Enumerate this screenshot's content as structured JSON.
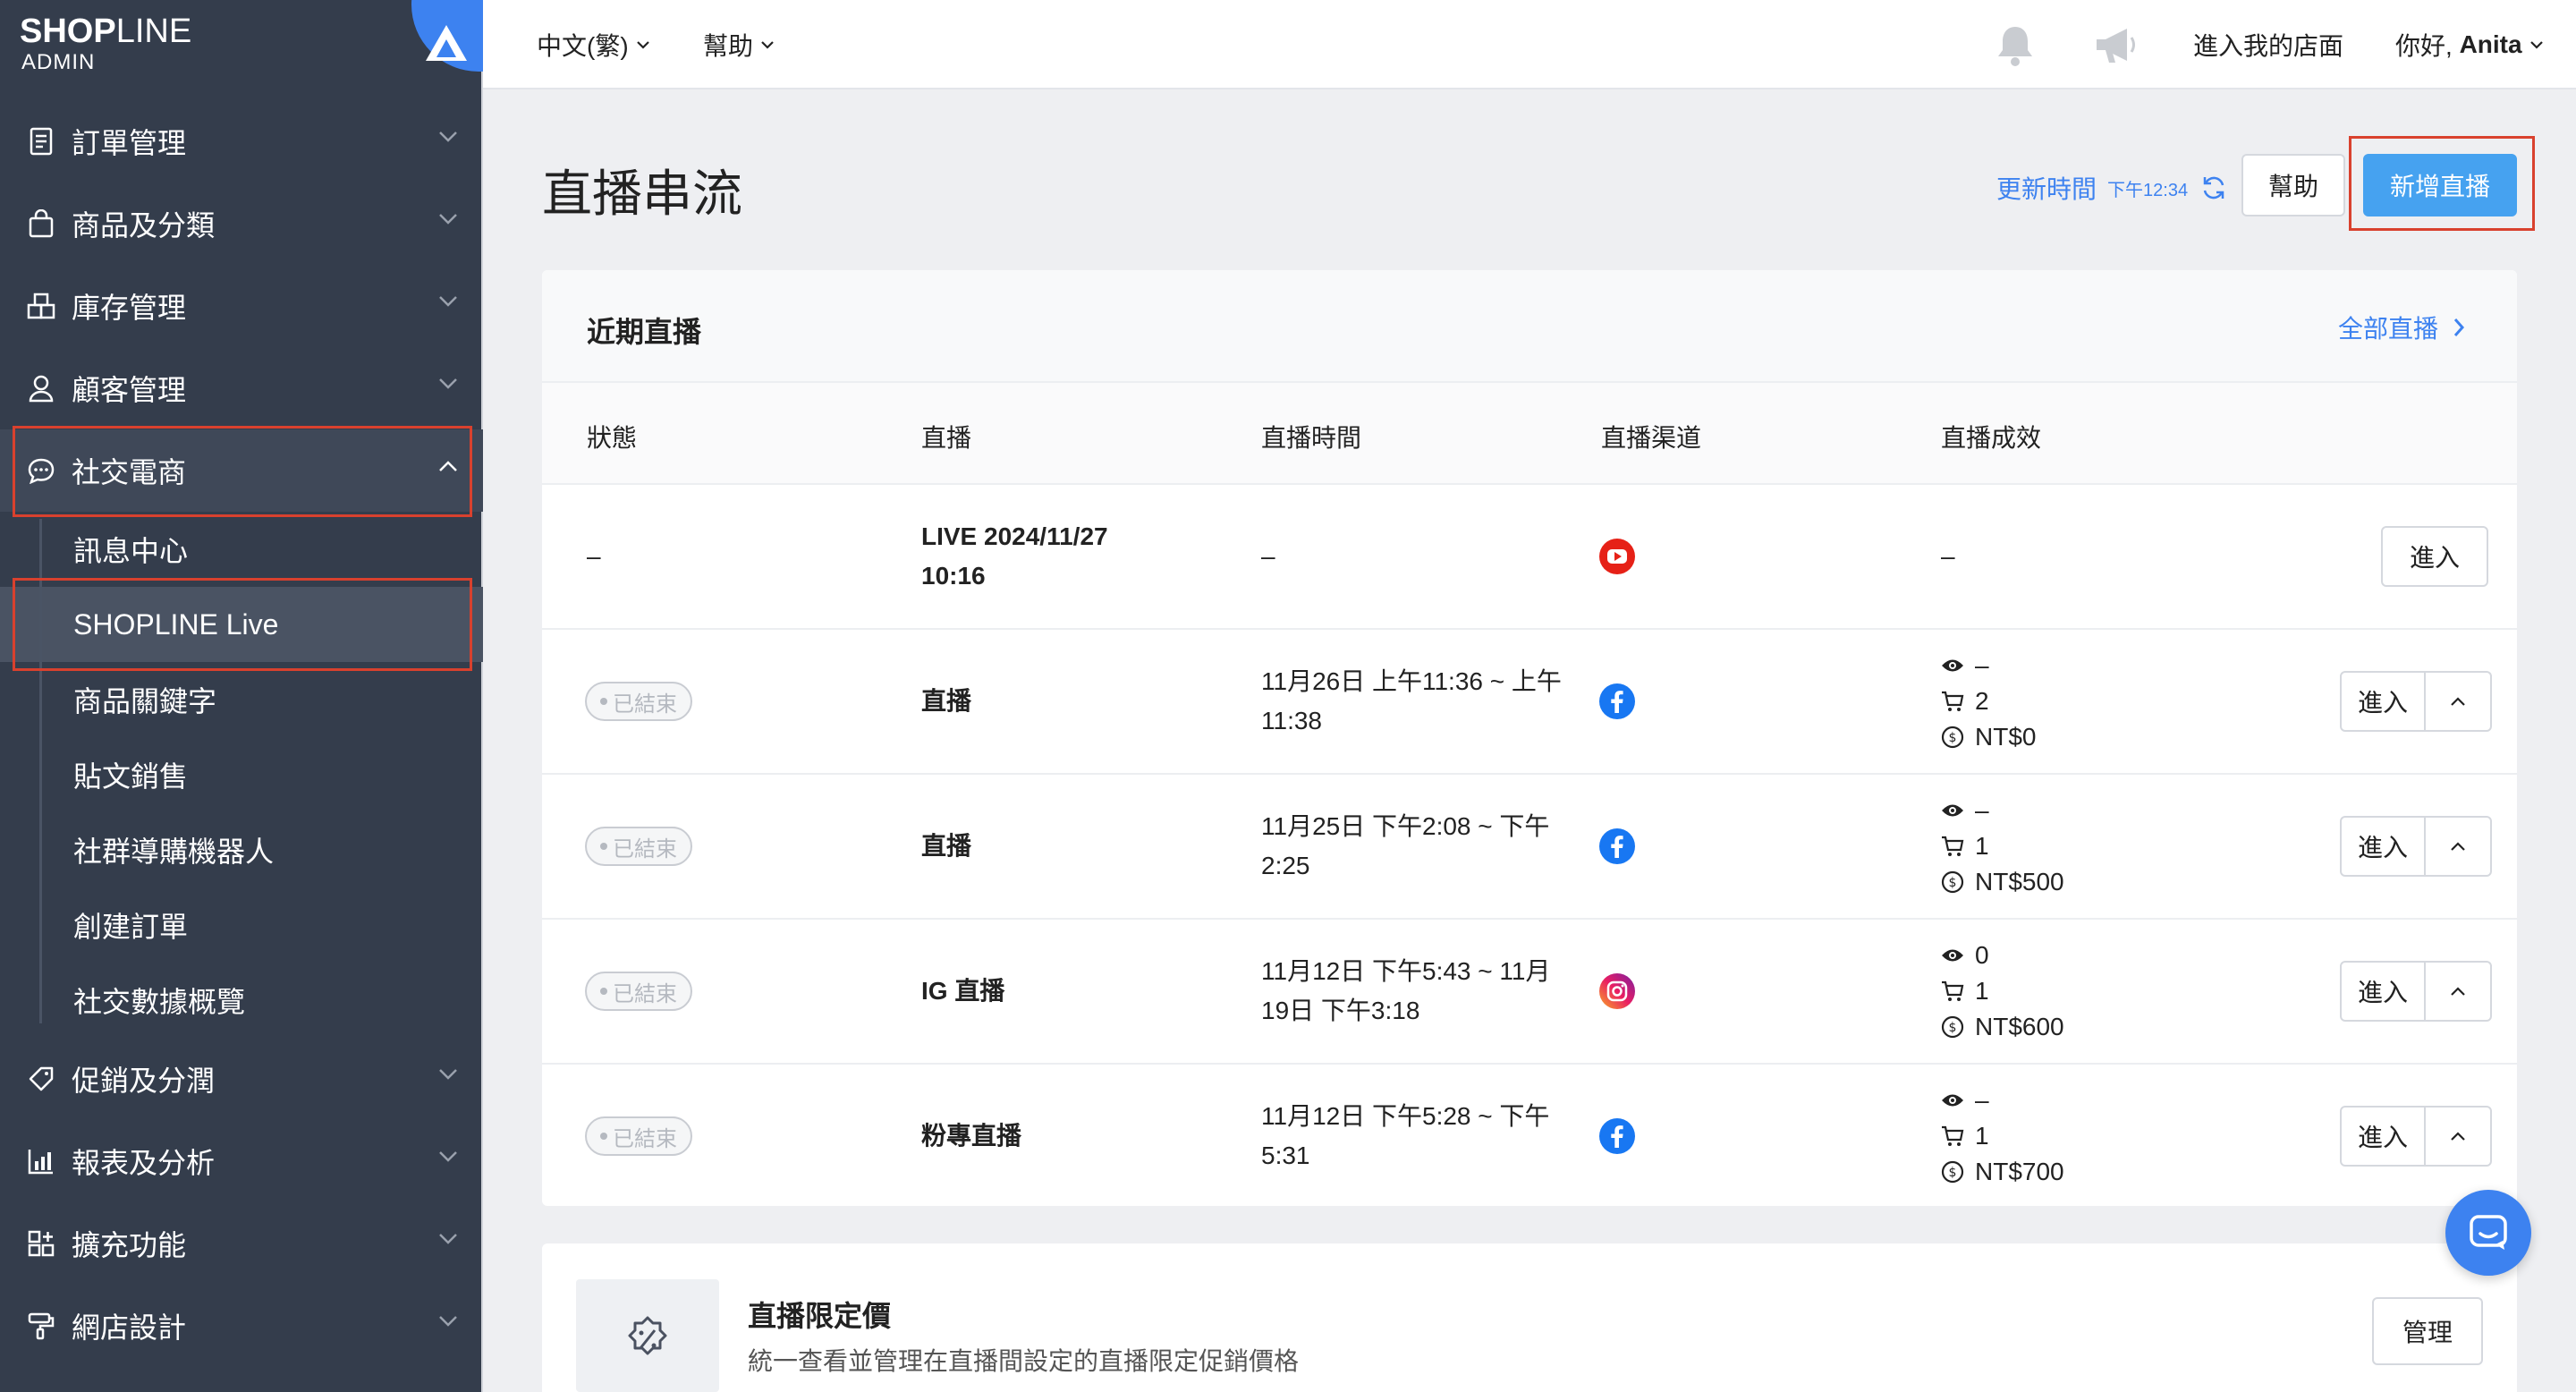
{
  "brand": {
    "logo_bold": "SHOP",
    "logo_thin": "LINE",
    "sub": "ADMIN",
    "accent": "#3d82f0"
  },
  "sidebar": {
    "items": [
      {
        "label": "訂單管理",
        "icon": "order-icon"
      },
      {
        "label": "商品及分類",
        "icon": "bag-icon"
      },
      {
        "label": "庫存管理",
        "icon": "inventory-icon"
      },
      {
        "label": "顧客管理",
        "icon": "customer-icon"
      },
      {
        "label": "社交電商",
        "icon": "chat-bubble-icon",
        "expanded": true
      },
      {
        "label": "促銷及分潤",
        "icon": "tag-icon"
      },
      {
        "label": "報表及分析",
        "icon": "chart-icon"
      },
      {
        "label": "擴充功能",
        "icon": "apps-icon"
      },
      {
        "label": "網店設計",
        "icon": "paint-roller-icon"
      }
    ],
    "social_sub": [
      {
        "label": "訊息中心"
      },
      {
        "label": "SHOPLINE Live",
        "active": true
      },
      {
        "label": "商品關鍵字"
      },
      {
        "label": "貼文銷售"
      },
      {
        "label": "社群導購機器人"
      },
      {
        "label": "創建訂單"
      },
      {
        "label": "社交數據概覽"
      }
    ]
  },
  "topbar": {
    "language": "中文(繁)",
    "help": "幫助",
    "store_link": "進入我的店面",
    "greeting_prefix": "你好, ",
    "user": "Anita"
  },
  "page": {
    "title": "直播串流",
    "update_label": "更新時間",
    "update_time": "下午12:34",
    "help_button": "幫助",
    "new_button": "新增直播"
  },
  "recent": {
    "title": "近期直播",
    "all_link": "全部直播",
    "columns": [
      "狀態",
      "直播",
      "直播時間",
      "直播渠道",
      "直播成效"
    ],
    "enter_label": "進入",
    "rows": [
      {
        "status": "–",
        "name": "LIVE 2024/11/27 10:16",
        "name_l1": "LIVE 2024/11/27",
        "name_l2": "10:16",
        "time_l1": "–",
        "time_l2": "",
        "channel": "youtube",
        "perf_dash": "–"
      },
      {
        "status": "已結束",
        "name": "直播",
        "time_l1": "11月26日 上午11:36 ~ 上午",
        "time_l2": "11:38",
        "channel": "facebook",
        "views": "–",
        "orders": "2",
        "sales": "NT$0"
      },
      {
        "status": "已結束",
        "name": "直播",
        "time_l1": "11月25日 下午2:08 ~ 下午",
        "time_l2": "2:25",
        "channel": "facebook",
        "views": "–",
        "orders": "1",
        "sales": "NT$500"
      },
      {
        "status": "已結束",
        "name": "IG 直播",
        "time_l1": "11月12日 下午5:43 ~ 11月",
        "time_l2": "19日 下午3:18",
        "channel": "instagram",
        "views": "0",
        "orders": "1",
        "sales": "NT$600"
      },
      {
        "status": "已結束",
        "name": "粉專直播",
        "time_l1": "11月12日 下午5:28 ~ 下午",
        "time_l2": "5:31",
        "channel": "facebook",
        "views": "–",
        "orders": "1",
        "sales": "NT$700"
      }
    ]
  },
  "limited_price": {
    "title": "直播限定價",
    "desc": "統一查看並管理在直播間設定的直播限定促銷價格",
    "button": "管理"
  }
}
